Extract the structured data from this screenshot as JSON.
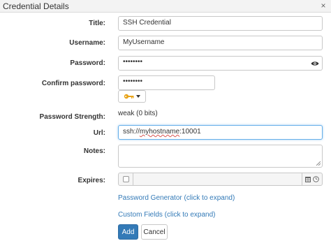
{
  "window": {
    "title": "Credential Details",
    "close_glyph": "×"
  },
  "labels": {
    "title": "Title:",
    "username": "Username:",
    "password": "Password:",
    "confirm_password": "Confirm password:",
    "password_strength": "Password Strength:",
    "url": "Url:",
    "notes": "Notes:",
    "expires": "Expires:"
  },
  "fields": {
    "title": "SSH Credential",
    "username": "MyUsername",
    "password_masked": "••••••••",
    "confirm_password_masked": "••••••••",
    "url_prefix": "ssh://",
    "url_host": "myhostname",
    "url_suffix": ":10001",
    "notes": ""
  },
  "strength_value": "weak (0 bits)",
  "key_button_icon": "key-icon",
  "links": {
    "password_generator": "Password Generator (click to expand)",
    "custom_fields": "Custom Fields (click to expand)"
  },
  "buttons": {
    "add": "Add",
    "cancel": "Cancel"
  },
  "colors": {
    "primary": "#337ab7",
    "link": "#337ab7",
    "focus": "#66afe9",
    "key": "#e8a317"
  }
}
